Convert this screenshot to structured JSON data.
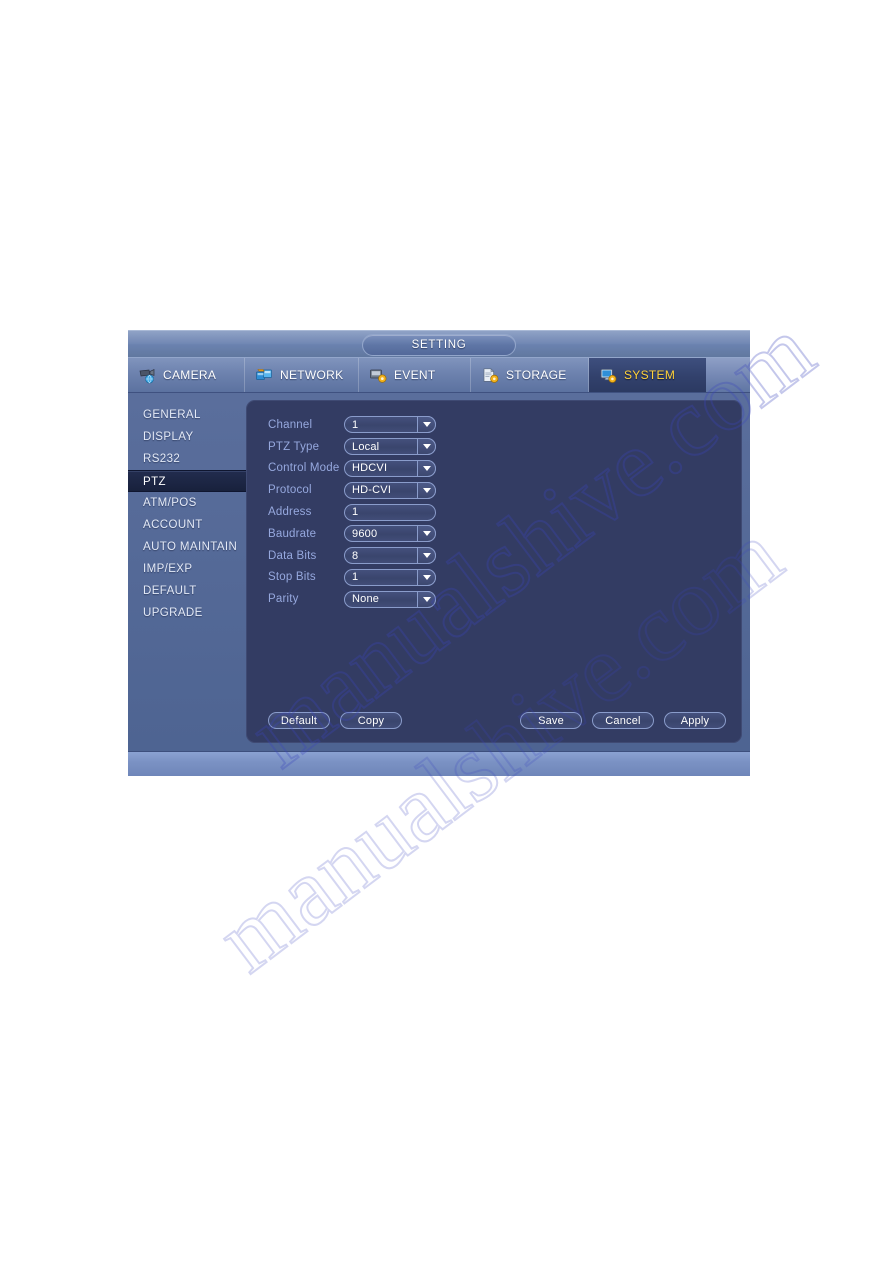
{
  "window": {
    "title": "SETTING"
  },
  "tabs": [
    {
      "label": "CAMERA",
      "icon": "camera-icon",
      "active": false
    },
    {
      "label": "NETWORK",
      "icon": "network-icon",
      "active": false
    },
    {
      "label": "EVENT",
      "icon": "event-icon",
      "active": false
    },
    {
      "label": "STORAGE",
      "icon": "storage-icon",
      "active": false
    },
    {
      "label": "SYSTEM",
      "icon": "system-icon",
      "active": true
    }
  ],
  "sidebar": {
    "items": [
      {
        "label": "GENERAL",
        "selected": false
      },
      {
        "label": "DISPLAY",
        "selected": false
      },
      {
        "label": "RS232",
        "selected": false
      },
      {
        "label": "PTZ",
        "selected": true
      },
      {
        "label": "ATM/POS",
        "selected": false
      },
      {
        "label": "ACCOUNT",
        "selected": false
      },
      {
        "label": "AUTO MAINTAIN",
        "selected": false
      },
      {
        "label": "IMP/EXP",
        "selected": false
      },
      {
        "label": "DEFAULT",
        "selected": false
      },
      {
        "label": "UPGRADE",
        "selected": false
      }
    ]
  },
  "form": {
    "fields": [
      {
        "label": "Channel",
        "value": "1",
        "dropdown": true
      },
      {
        "label": "PTZ Type",
        "value": "Local",
        "dropdown": true
      },
      {
        "label": "Control Mode",
        "value": "HDCVI",
        "dropdown": true
      },
      {
        "label": "Protocol",
        "value": "HD-CVI",
        "dropdown": true
      },
      {
        "label": "Address",
        "value": "1",
        "dropdown": false
      },
      {
        "label": "Baudrate",
        "value": "9600",
        "dropdown": true
      },
      {
        "label": "Data Bits",
        "value": "8",
        "dropdown": true
      },
      {
        "label": "Stop Bits",
        "value": "1",
        "dropdown": true
      },
      {
        "label": "Parity",
        "value": "None",
        "dropdown": true
      }
    ]
  },
  "buttons": {
    "left": [
      {
        "label": "Default"
      },
      {
        "label": "Copy"
      }
    ],
    "right": [
      {
        "label": "Save"
      },
      {
        "label": "Cancel"
      },
      {
        "label": "Apply"
      }
    ]
  },
  "watermark": {
    "text": "manualshive.com"
  },
  "colors": {
    "accent_active_tab_text": "#ffd23a",
    "panel_bg": "#333c63",
    "sidebar_selected_bg": "#18213c",
    "label_text": "#96a8de",
    "field_border": "#8a9ccb"
  }
}
